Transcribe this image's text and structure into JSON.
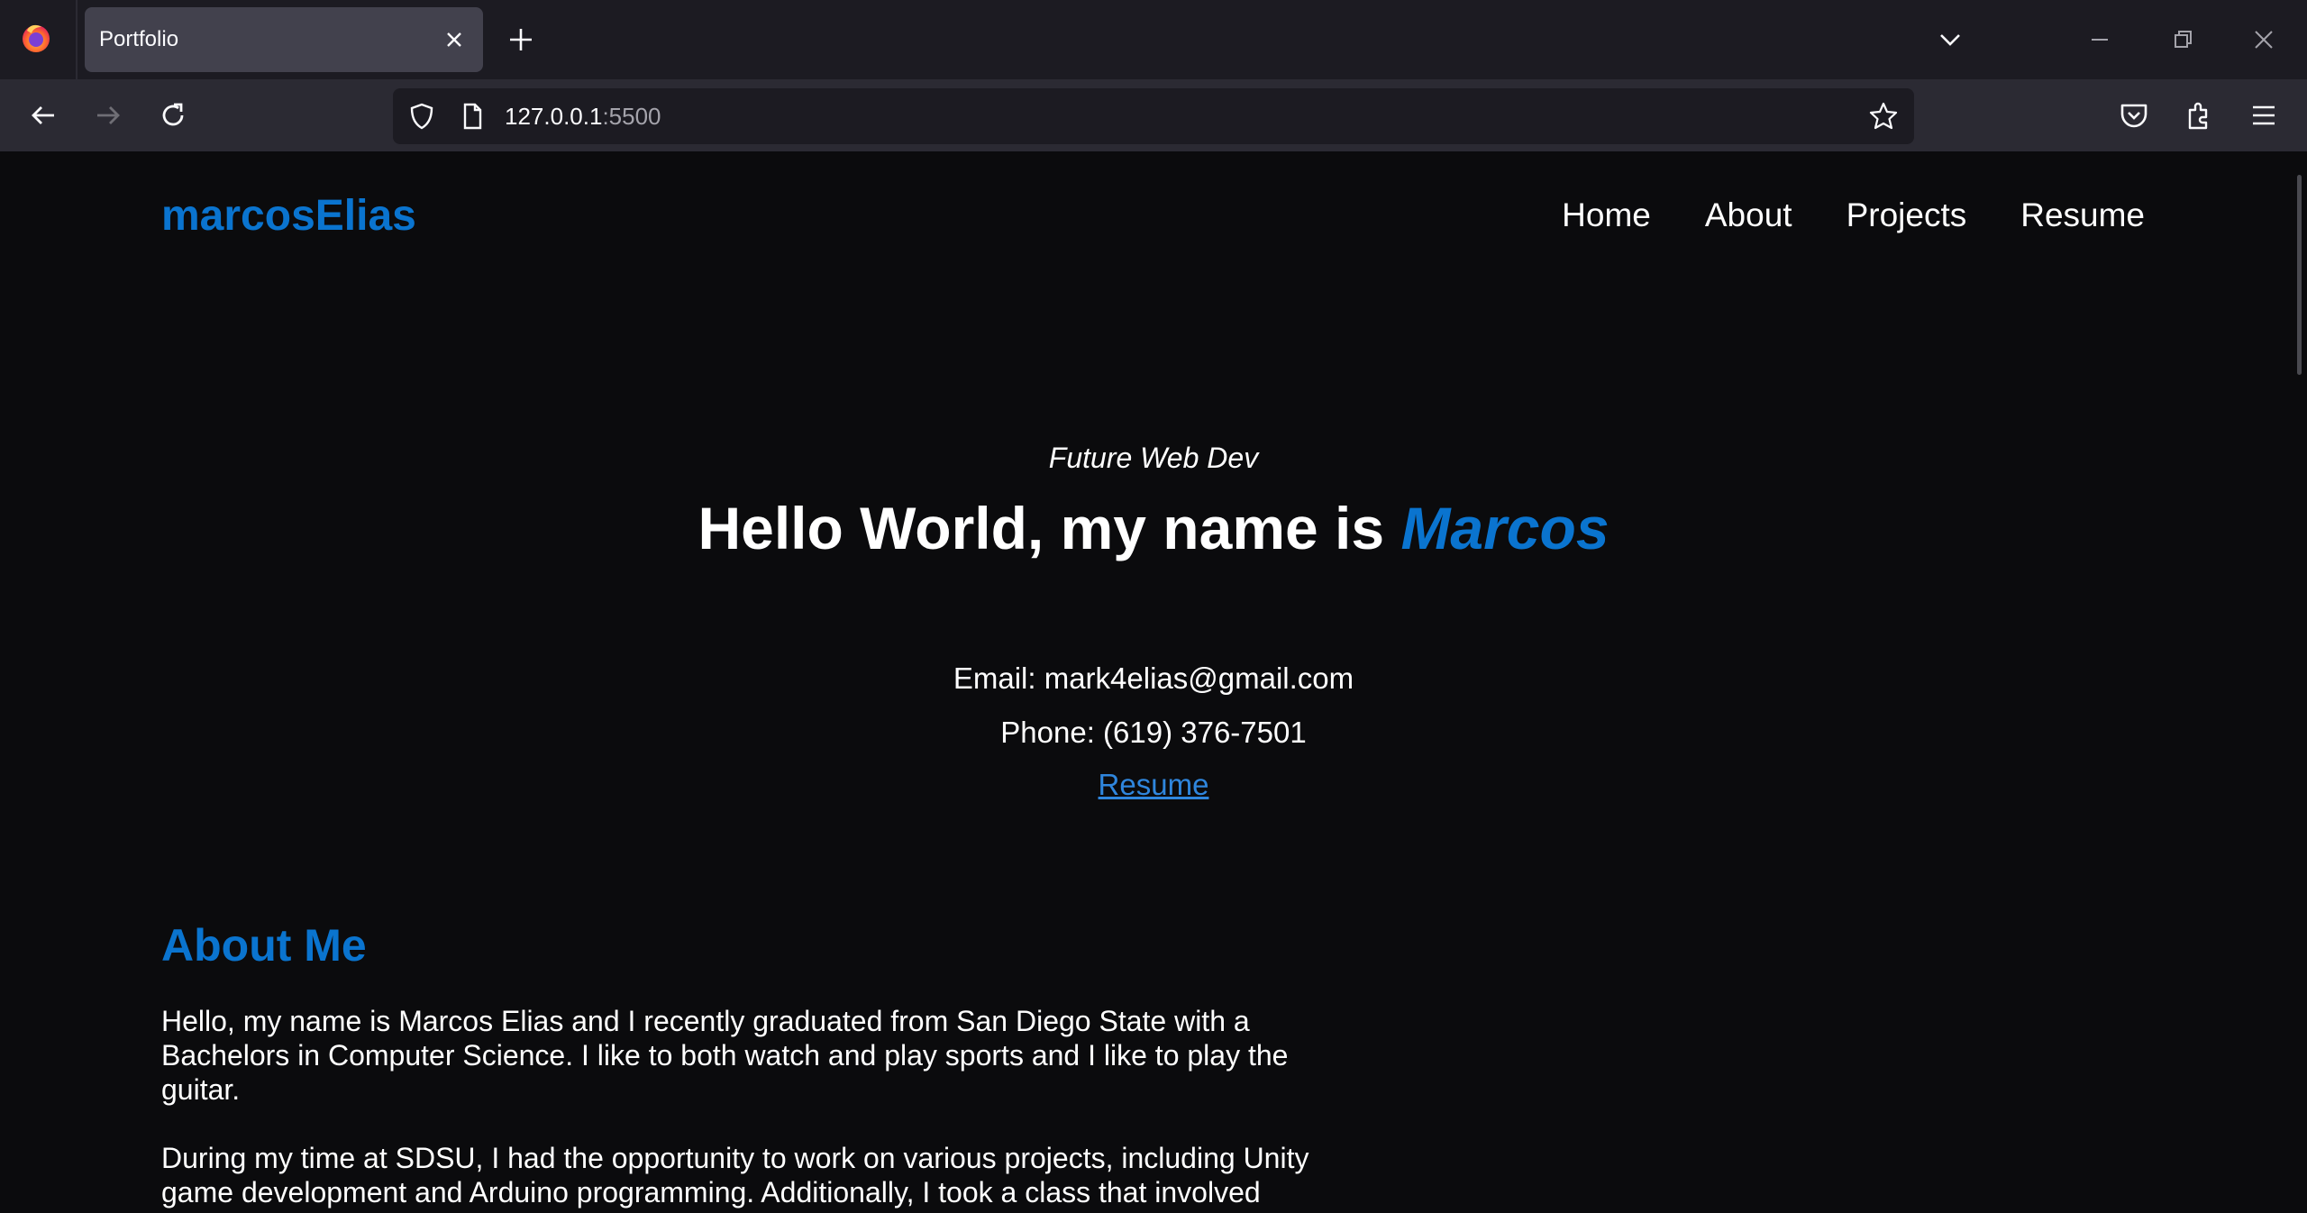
{
  "browser": {
    "tab_title": "Portfolio",
    "url_host": "127.0.0.1",
    "url_port": ":5500"
  },
  "site": {
    "brand": "marcosElias",
    "nav": [
      "Home",
      "About",
      "Projects",
      "Resume"
    ],
    "hero": {
      "subtitle": "Future Web Dev",
      "title_prefix": "Hello World, my name is ",
      "title_name": "Marcos"
    },
    "contact": {
      "email": "Email: mark4elias@gmail.com",
      "phone": "Phone: (619) 376-7501",
      "resume_link": "Resume"
    },
    "about": {
      "heading": "About Me",
      "p1_line1": "Hello, my name is Marcos Elias and I recently graduated from San Diego State with a",
      "p1_line2": "Bachelors in Computer Science. I like to both watch and play sports and I like to play the",
      "p1_line3": "guitar.",
      "p2_line1": "During my time at SDSU, I had the opportunity to work on various projects, including Unity",
      "p2_line2": "game development and Arduino programming. Additionally, I took a class that involved"
    }
  },
  "colors": {
    "accent": "#0a74cf",
    "link": "#2f86dd",
    "page_bg": "#0b0b0d",
    "chrome_bg": "#1c1b22",
    "toolbar_bg": "#2b2a33"
  },
  "icons": [
    "firefox-logo-icon",
    "close-icon",
    "plus-icon",
    "chevron-down-icon",
    "minimize-icon",
    "restore-icon",
    "back-icon",
    "forward-icon",
    "reload-icon",
    "shield-icon",
    "page-icon",
    "star-icon",
    "pocket-icon",
    "extensions-icon",
    "menu-icon"
  ]
}
